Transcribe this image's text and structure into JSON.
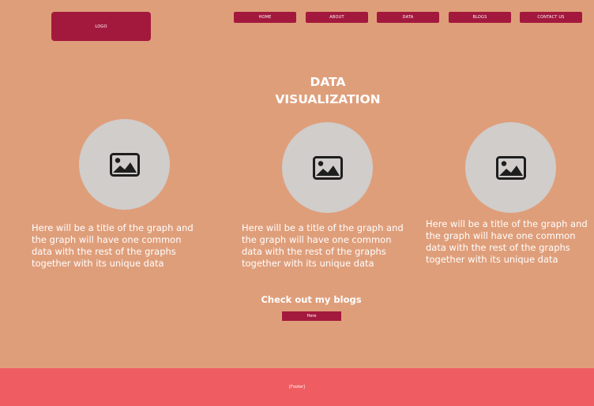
{
  "header": {
    "logo_label": "LOGO",
    "nav": [
      {
        "label": "HOME"
      },
      {
        "label": "ABOUT"
      },
      {
        "label": "DATA"
      },
      {
        "label": "BLOGS"
      },
      {
        "label": "CONTACT US"
      }
    ]
  },
  "main": {
    "title_line1": "DATA",
    "title_line2": "VISUALIZATION",
    "cards": [
      {
        "icon": "image-placeholder-icon",
        "description": "Here will be a title of the graph and the graph will have one common data with the rest of the graphs together with its unique data"
      },
      {
        "icon": "image-placeholder-icon",
        "description": "Here will be a title of the graph and the graph will have one common data with the rest of the graphs together with its unique data"
      },
      {
        "icon": "image-placeholder-icon",
        "description": "Here will be a title of the graph and the graph will have one common data with the rest of the graphs together with its unique data"
      }
    ],
    "blogs_heading": "Check out my blogs",
    "blogs_button": "Here"
  },
  "footer": {
    "text": "[Footer]"
  },
  "colors": {
    "background": "#df9e7a",
    "accent": "#a3193d",
    "footer": "#ef5d62",
    "circle": "#d0cdcb",
    "icon": "#1e1e1e"
  }
}
